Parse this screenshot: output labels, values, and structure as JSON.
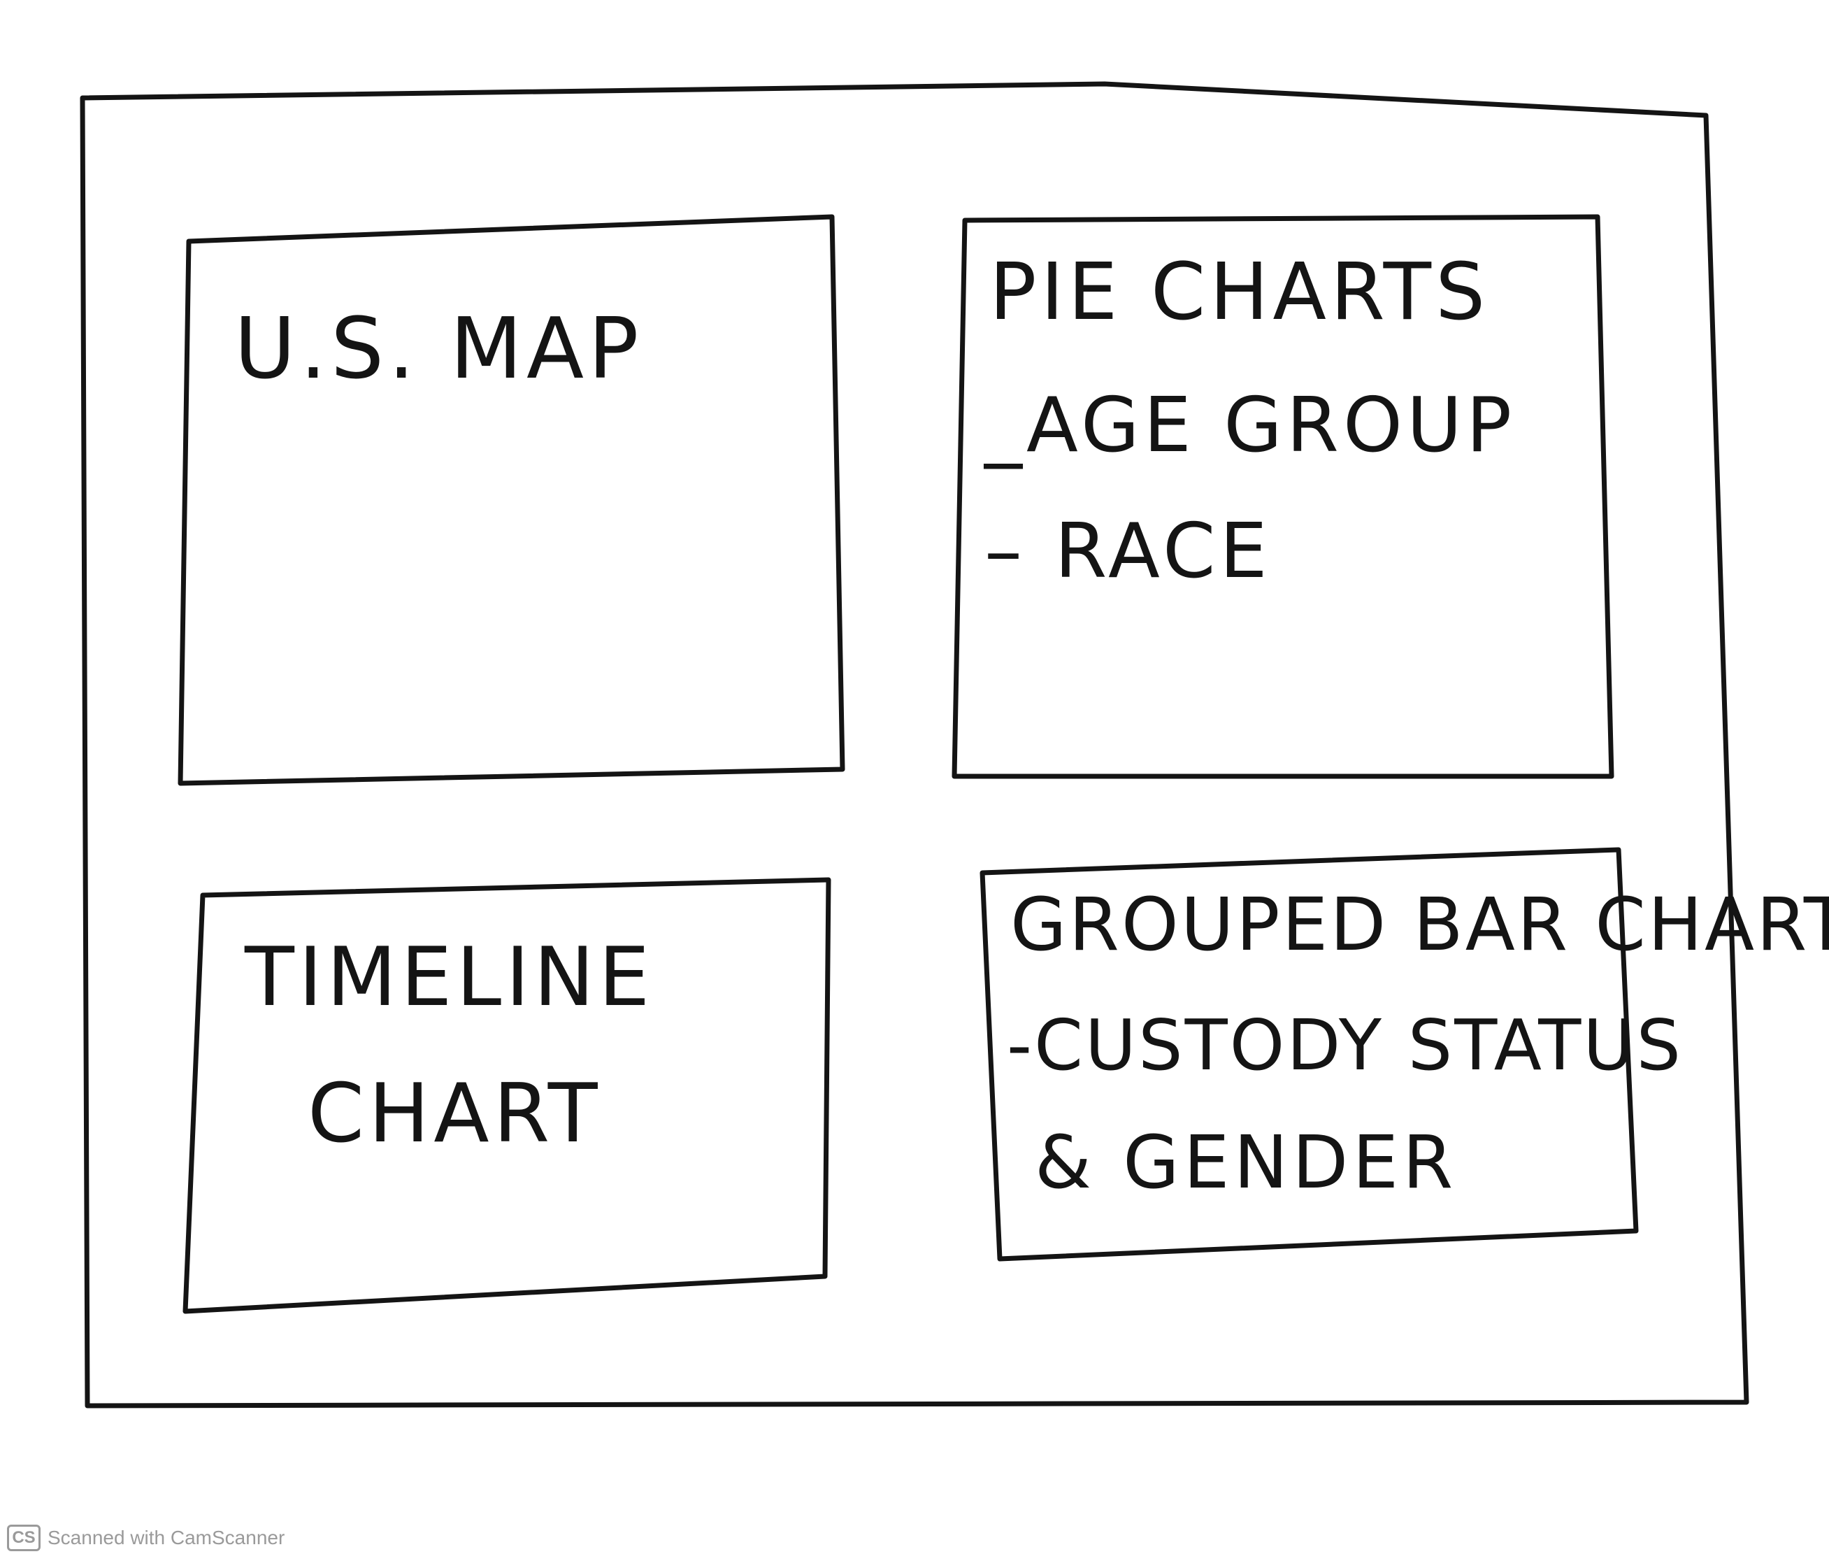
{
  "panels": {
    "map": {
      "title": "U.S. MAP"
    },
    "pie": {
      "title": "PIE CHARTS",
      "items": [
        "_AGE GROUP",
        "– RACE"
      ]
    },
    "timeline": {
      "title_line1": "TIMELINE",
      "title_line2": "CHART"
    },
    "grouped_bar": {
      "title": "GROUPED BAR CHART",
      "line1": "-CUSTODY STATUS",
      "line2": "& GENDER"
    }
  },
  "watermark": {
    "logo": "CS",
    "text": "Scanned with CamScanner"
  },
  "colors": {
    "ink": "#141414",
    "paper": "#ffffff",
    "watermark": "#9a9a9a"
  }
}
